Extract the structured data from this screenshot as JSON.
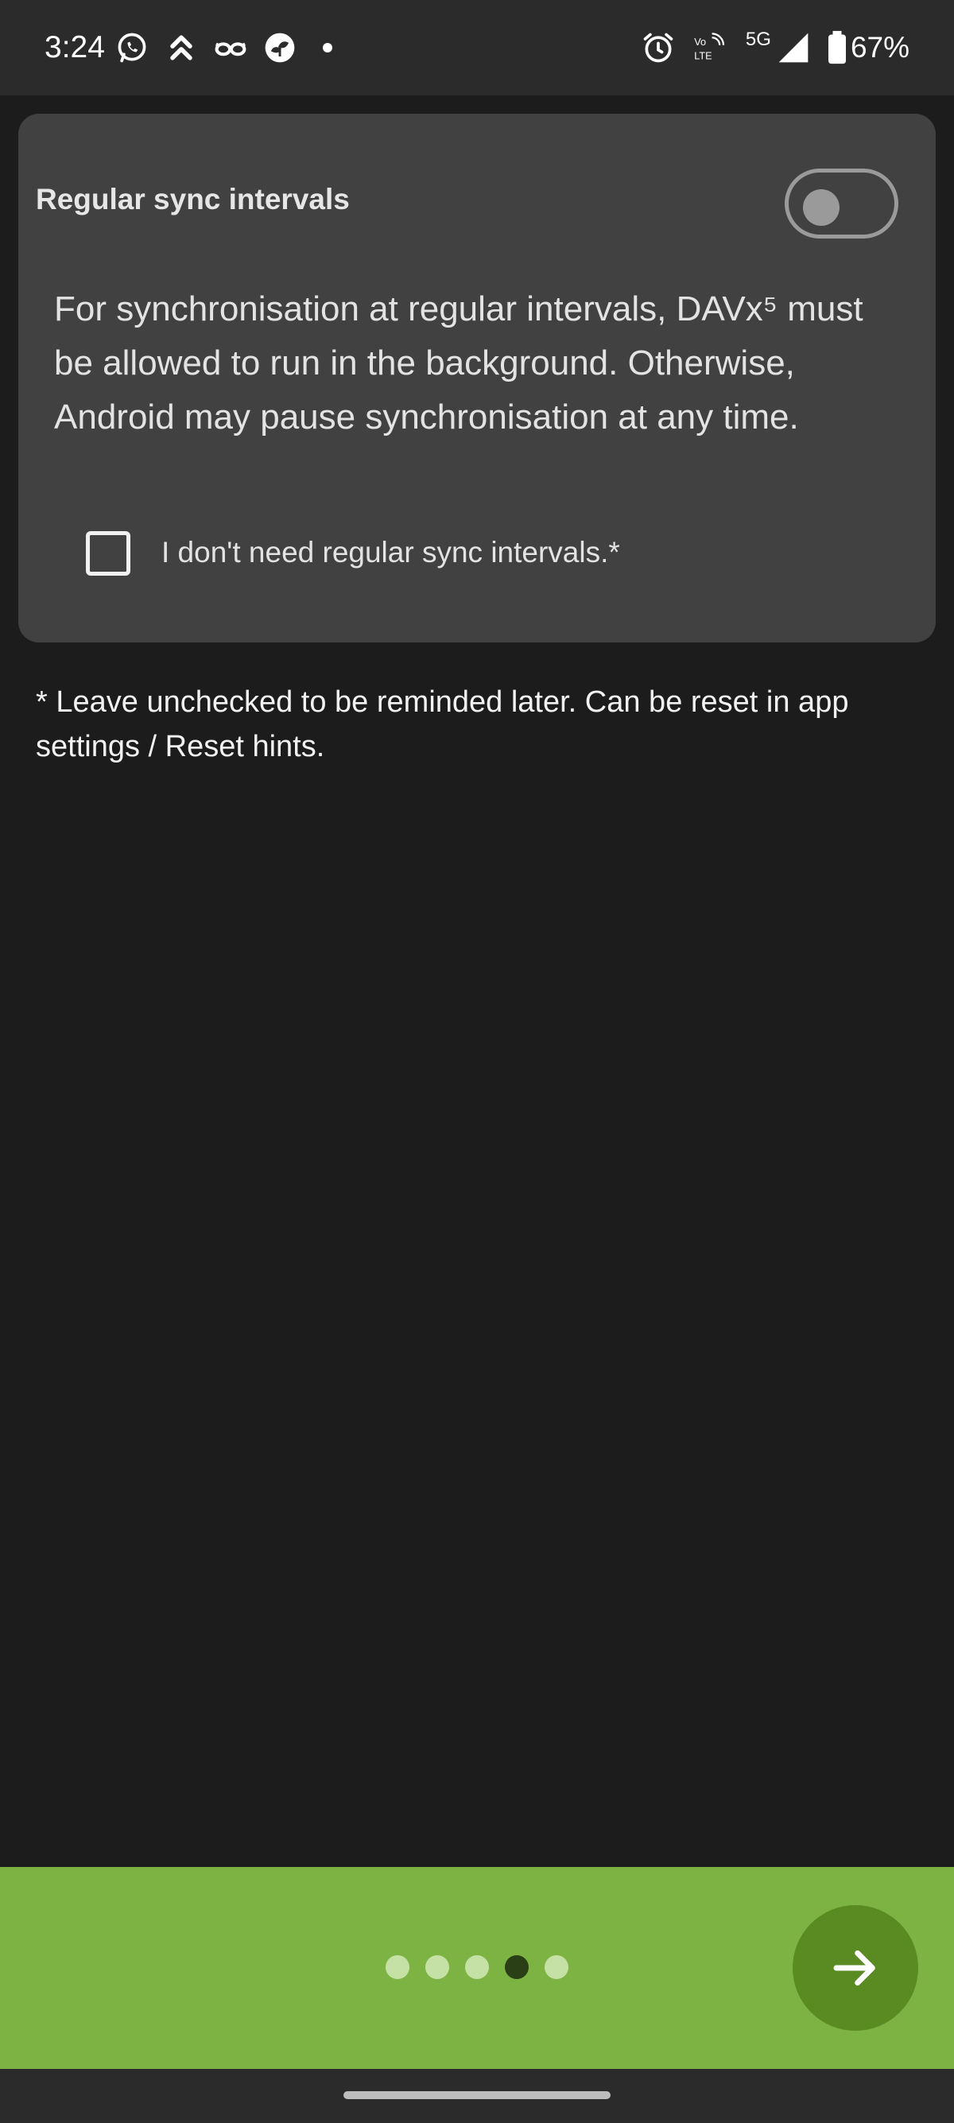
{
  "status_bar": {
    "time": "3:24",
    "network": "5G",
    "battery": "67%",
    "left_icons": [
      "whatsapp-icon",
      "upload-icon",
      "glasses-icon",
      "plant-icon"
    ],
    "right_icons": [
      "alarm-icon",
      "volte-icon",
      "signal-icon",
      "battery-icon"
    ]
  },
  "card": {
    "title": "Regular sync intervals",
    "toggle_on": false,
    "body": "For synchronisation at regular intervals, DAVx⁵ must be allowed to run in the background. Otherwise, Android may pause synchronisation at any time.",
    "checkbox_label": "I don't need regular sync intervals.*",
    "checkbox_checked": false
  },
  "footnote": "* Leave unchecked to be reminded later. Can be reset in app settings / Reset hints.",
  "pager": {
    "total_pages": 5,
    "current_page": 4
  },
  "colors": {
    "background": "#1c1c1c",
    "card": "#414141",
    "bottom_bar": "#7cb342",
    "next_button": "#5a8a22",
    "dot_inactive": "#c5e1a5",
    "dot_active": "#2b3f16"
  }
}
